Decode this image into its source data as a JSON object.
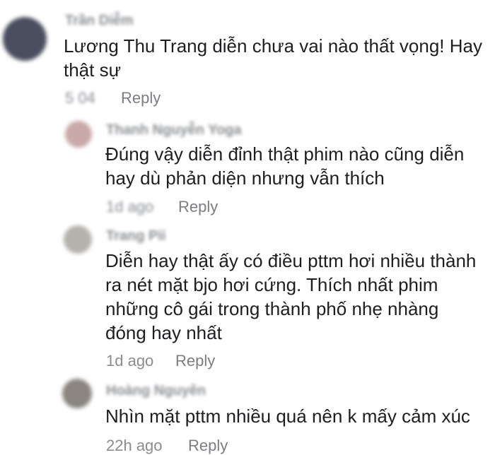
{
  "comments": [
    {
      "author": "Trần Diễm",
      "text": "Lương Thu Trang diễn chưa vai nào thất vọng! Hay\nthật sự",
      "time": "5 04",
      "reply_label": "Reply",
      "avatar_color": "#4a4e5e"
    },
    {
      "author": "Thanh Nguyễn Yoga",
      "text": "Đúng vậy diễn đỉnh thật phim nào cũng diễn\nhay dù phản diện nhưng vẫn thích",
      "time": "1d ago",
      "reply_label": "Reply",
      "avatar_color": "#c9a9a9"
    },
    {
      "author": "Trang Pii",
      "text": "Diễn hay thật ấy có điều pttm hơi nhiều thành\nra nét mặt bjo hơi cứng. Thích nhất phim\nnhững cô gái trong thành phố nhẹ nhàng\nđóng hay nhất",
      "time": "1d ago",
      "reply_label": "Reply",
      "avatar_color": "#b5b1ad"
    },
    {
      "author": "Hoàng Nguyên",
      "text": "Nhìn mặt pttm nhiều quá nên k mấy cảm xúc",
      "time": "22h ago",
      "reply_label": "Reply",
      "avatar_color": "#8a8580"
    }
  ]
}
